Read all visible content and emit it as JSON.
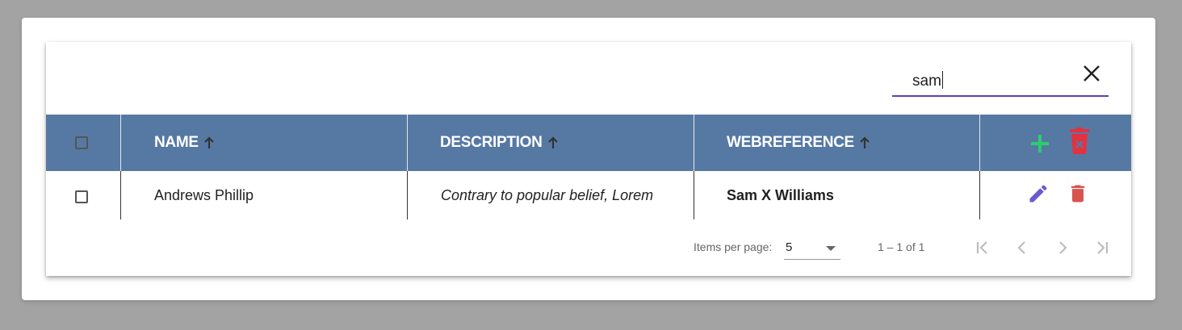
{
  "search": {
    "value": "sam"
  },
  "table": {
    "columns": [
      {
        "label": "NAME",
        "sort": "ascending"
      },
      {
        "label": "DESCRIPTION",
        "sort": "ascending"
      },
      {
        "label": "WEBREFERENCE",
        "sort": "ascending"
      }
    ],
    "rows": [
      {
        "name": "Andrews Phillip",
        "description": "Contrary to popular belief, Lorem",
        "webreference": "Sam X Williams",
        "selected": false
      }
    ],
    "header_actions": [
      "add-icon",
      "delete-all-icon"
    ],
    "row_actions": [
      "edit-icon",
      "delete-icon"
    ]
  },
  "paginator": {
    "items_per_page_label": "Items per page:",
    "page_size": "5",
    "range_label": "1 – 1 of 1"
  },
  "colors": {
    "header_bg": "#5679a4",
    "search_underline": "#673ab7",
    "add_icon": "#2ecc71",
    "delete_all_icon": "#e3323f",
    "edit_icon": "#6a5acd",
    "delete_icon": "#d9534f"
  }
}
